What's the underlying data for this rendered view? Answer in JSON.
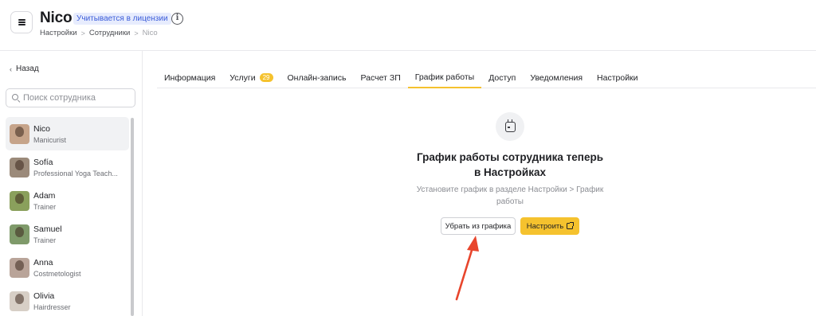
{
  "header": {
    "title": "Nico",
    "license_badge": "Учитывается в лицензии",
    "info_glyph": "i",
    "breadcrumb": [
      "Настройки",
      "Сотрудники",
      "Nico"
    ],
    "breadcrumb_separator": ">"
  },
  "sidebar": {
    "back_label": "Назад",
    "back_glyph": "‹",
    "search_placeholder": "Поиск сотрудника",
    "employees": [
      {
        "name": "Nico",
        "role": "Manicurist",
        "active": true,
        "avatar_color": "#c6a48a"
      },
      {
        "name": "Sofía",
        "role": "Professional Yoga Teach...",
        "active": false,
        "avatar_color": "#9b8a7a"
      },
      {
        "name": "Adam",
        "role": "Trainer",
        "active": false,
        "avatar_color": "#8aa05c"
      },
      {
        "name": "Samuel",
        "role": "Trainer",
        "active": false,
        "avatar_color": "#7f9a6a"
      },
      {
        "name": "Anna",
        "role": "Costmetologist",
        "active": false,
        "avatar_color": "#b9a499"
      },
      {
        "name": "Olivia",
        "role": "Hairdresser",
        "active": false,
        "avatar_color": "#d7cfc6"
      }
    ]
  },
  "tabs": [
    {
      "label": "Информация",
      "badge": "",
      "active": false
    },
    {
      "label": "Услуги",
      "badge": "29",
      "active": false
    },
    {
      "label": "Онлайн-запись",
      "badge": "",
      "active": false
    },
    {
      "label": "Расчет ЗП",
      "badge": "",
      "active": false
    },
    {
      "label": "График работы",
      "badge": "",
      "active": true
    },
    {
      "label": "Доступ",
      "badge": "",
      "active": false
    },
    {
      "label": "Уведомления",
      "badge": "",
      "active": false
    },
    {
      "label": "Настройки",
      "badge": "",
      "active": false
    }
  ],
  "main": {
    "icon": "calendar-icon",
    "title": "График работы сотрудника теперь в Настройках",
    "subtitle": "Установите график в разделе Настройки > График работы",
    "remove_button": "Убрать из графика",
    "setup_button": "Настроить"
  },
  "colors": {
    "accent": "#f5c22e",
    "badge_bg": "#e7ecfd",
    "badge_text": "#3a5bd9",
    "annotation_arrow": "#e8452c"
  }
}
